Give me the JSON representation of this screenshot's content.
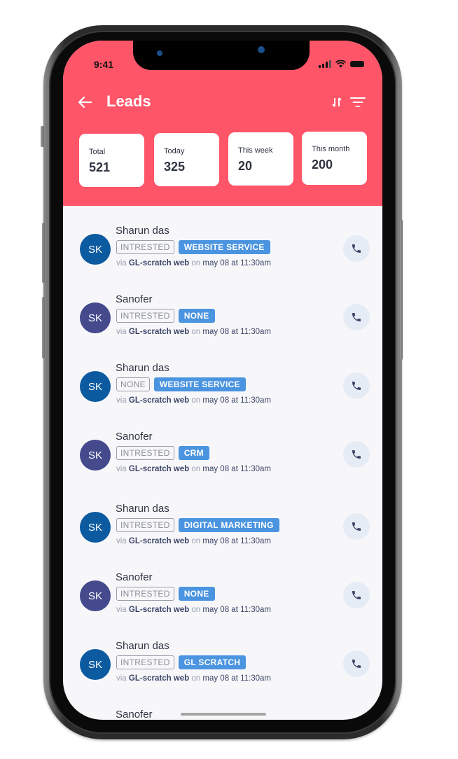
{
  "status_bar": {
    "time": "9:41"
  },
  "header": {
    "title": "Leads",
    "back_icon": "arrow-left-icon",
    "sort_icon": "sort-arrows-icon",
    "filter_icon": "filter-icon",
    "background_color": "#ff5568"
  },
  "stats": [
    {
      "label": "Total",
      "value": "521"
    },
    {
      "label": "Today",
      "value": "325"
    },
    {
      "label": "This week",
      "value": "20"
    },
    {
      "label": "This month",
      "value": "200"
    }
  ],
  "leads": [
    {
      "initials": "SK",
      "name": "Sharun das",
      "status": "INTRESTED",
      "service": "WEBSITE SERVICE",
      "via_prefix": "via",
      "source": "GL-scratch web",
      "on_text": "on",
      "datetime": "may 08 at 11:30am",
      "avatar_color": "#0c5aa0"
    },
    {
      "initials": "SK",
      "name": "Sanofer",
      "status": "INTRESTED",
      "service": "NONE",
      "via_prefix": "via",
      "source": "GL-scratch web",
      "on_text": "on",
      "datetime": "may 08 at 11:30am",
      "avatar_color": "#444a8c"
    },
    {
      "initials": "SK",
      "name": "Sharun das",
      "status": "NONE",
      "service": "WEBSITE SERVICE",
      "via_prefix": "via",
      "source": "GL-scratch web",
      "on_text": "on",
      "datetime": "may 08 at 11:30am",
      "avatar_color": "#0c5aa0"
    },
    {
      "initials": "SK",
      "name": "Sanofer",
      "status": "INTRESTED",
      "service": "CRM",
      "via_prefix": "via",
      "source": "GL-scratch web",
      "on_text": "on",
      "datetime": "may 08 at 11:30am",
      "avatar_color": "#444a8c"
    },
    {
      "initials": "SK",
      "name": "Sharun das",
      "status": "INTRESTED",
      "service": "DIGITAL MARKETING",
      "via_prefix": "via",
      "source": "GL-scratch web",
      "on_text": "on",
      "datetime": "may 08 at 11:30am",
      "avatar_color": "#0c5aa0"
    },
    {
      "initials": "SK",
      "name": "Sanofer",
      "status": "INTRESTED",
      "service": "NONE",
      "via_prefix": "via",
      "source": "GL-scratch web",
      "on_text": "on",
      "datetime": "may 08 at 11:30am",
      "avatar_color": "#444a8c"
    },
    {
      "initials": "SK",
      "name": "Sharun das",
      "status": "INTRESTED",
      "service": "GL SCRATCH",
      "via_prefix": "via",
      "source": "GL-scratch web",
      "on_text": "on",
      "datetime": "may 08 at 11:30am",
      "avatar_color": "#0c5aa0"
    },
    {
      "name": "Sanofer"
    }
  ]
}
